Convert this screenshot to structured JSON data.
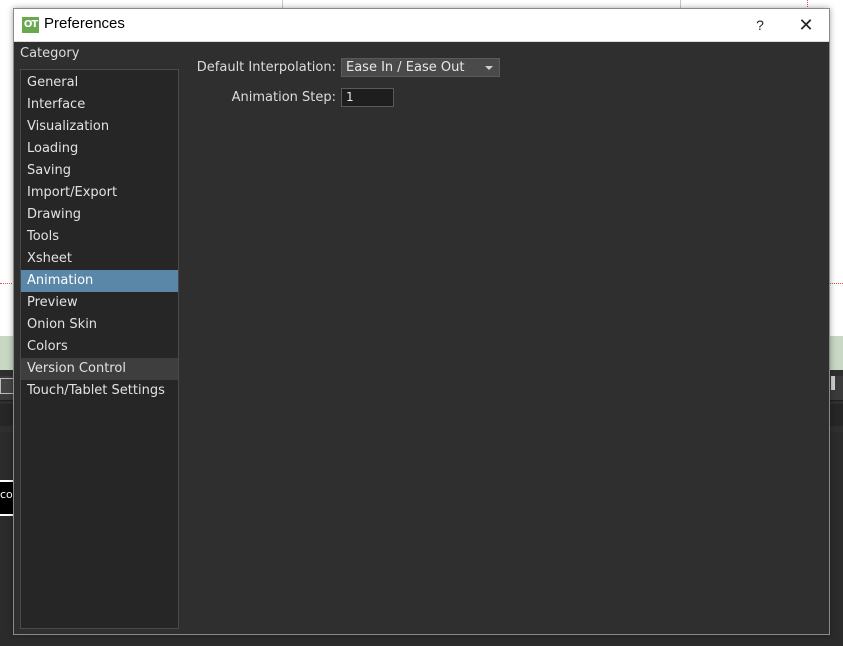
{
  "window": {
    "title": "Preferences",
    "app_icon_text": "OT",
    "help_label": "?",
    "close_label": "✕"
  },
  "sidebar": {
    "header": "Category",
    "items": [
      {
        "label": "General"
      },
      {
        "label": "Interface"
      },
      {
        "label": "Visualization"
      },
      {
        "label": "Loading"
      },
      {
        "label": "Saving"
      },
      {
        "label": "Import/Export"
      },
      {
        "label": "Drawing"
      },
      {
        "label": "Tools"
      },
      {
        "label": "Xsheet"
      },
      {
        "label": "Animation",
        "selected": true
      },
      {
        "label": "Preview"
      },
      {
        "label": "Onion Skin"
      },
      {
        "label": "Colors"
      },
      {
        "label": "Version Control",
        "hovered": true
      },
      {
        "label": "Touch/Tablet Settings"
      }
    ]
  },
  "animation_settings": {
    "interpolation_label": "Default Interpolation:",
    "interpolation_value": "Ease In / Ease Out",
    "step_label": "Animation Step:",
    "step_value": "1"
  },
  "background": {
    "cell_text": "col"
  },
  "colors": {
    "selected": "#5a86a8",
    "dialog_bg": "#2f2f2f",
    "list_bg": "#262626",
    "app_icon": "#6aa84f"
  }
}
